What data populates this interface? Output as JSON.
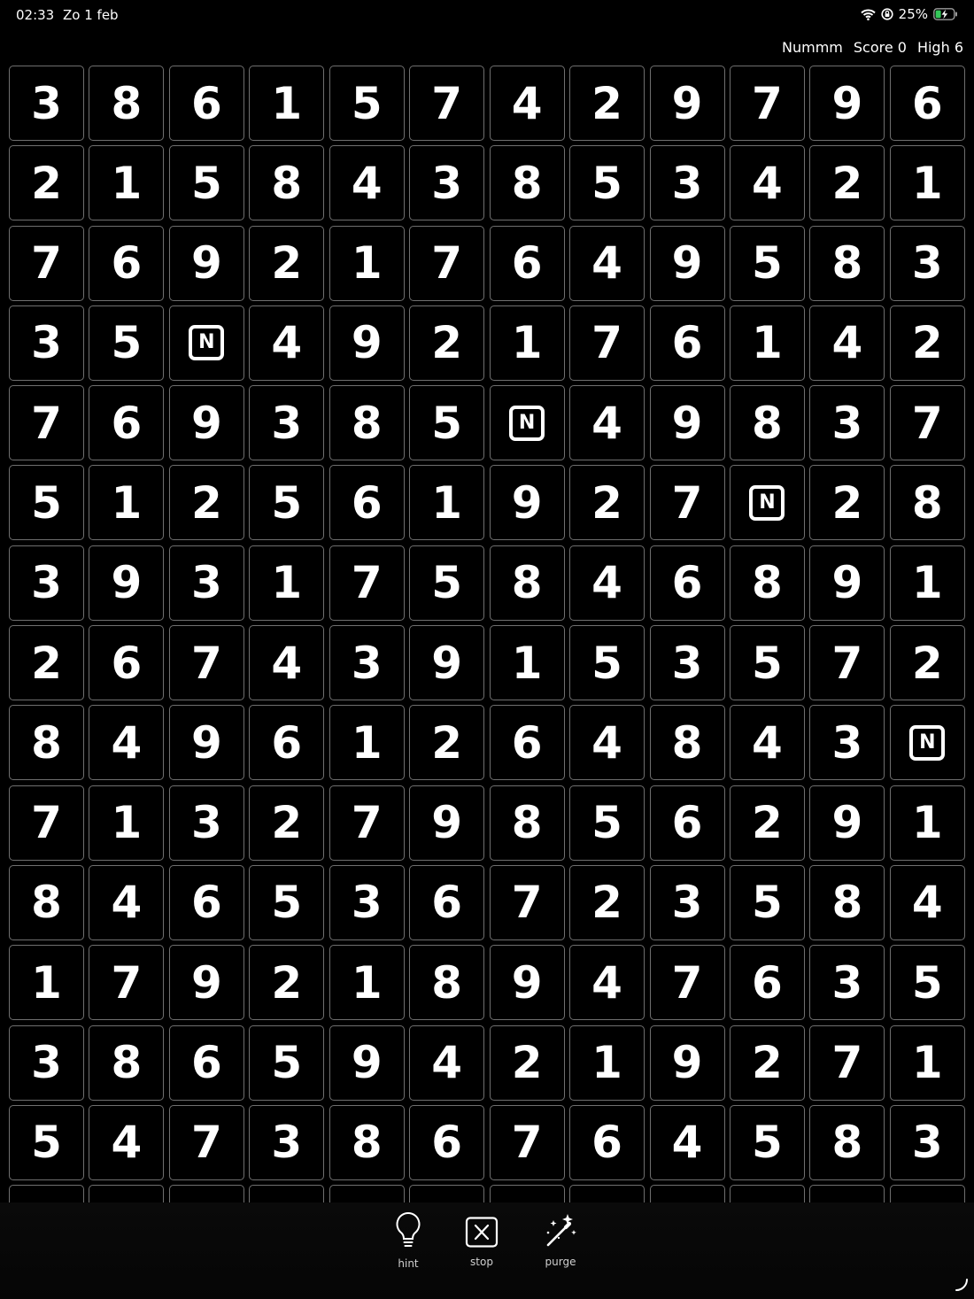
{
  "status_bar": {
    "time": "02:33",
    "date": "Zo 1 feb",
    "battery": "25%",
    "icons": [
      "wifi-icon",
      "orientation-lock-icon",
      "battery-charging-icon"
    ]
  },
  "header": {
    "app_name": "Nummm",
    "score": "Score 0",
    "high": "High 6"
  },
  "board": {
    "columns": 12,
    "special_tile_letter": "N",
    "rows": [
      [
        "3",
        "8",
        "6",
        "1",
        "5",
        "7",
        "4",
        "2",
        "9",
        "7",
        "9",
        "6"
      ],
      [
        "2",
        "1",
        "5",
        "8",
        "4",
        "3",
        "8",
        "5",
        "3",
        "4",
        "2",
        "1"
      ],
      [
        "7",
        "6",
        "9",
        "2",
        "1",
        "7",
        "6",
        "4",
        "9",
        "5",
        "8",
        "3"
      ],
      [
        "3",
        "5",
        "N",
        "4",
        "9",
        "2",
        "1",
        "7",
        "6",
        "1",
        "4",
        "2"
      ],
      [
        "7",
        "6",
        "9",
        "3",
        "8",
        "5",
        "N",
        "4",
        "9",
        "8",
        "3",
        "7"
      ],
      [
        "5",
        "1",
        "2",
        "5",
        "6",
        "1",
        "9",
        "2",
        "7",
        "N",
        "2",
        "8"
      ],
      [
        "3",
        "9",
        "3",
        "1",
        "7",
        "5",
        "8",
        "4",
        "6",
        "8",
        "9",
        "1"
      ],
      [
        "2",
        "6",
        "7",
        "4",
        "3",
        "9",
        "1",
        "5",
        "3",
        "5",
        "7",
        "2"
      ],
      [
        "8",
        "4",
        "9",
        "6",
        "1",
        "2",
        "6",
        "4",
        "8",
        "4",
        "3",
        "N"
      ],
      [
        "7",
        "1",
        "3",
        "2",
        "7",
        "9",
        "8",
        "5",
        "6",
        "2",
        "9",
        "1"
      ],
      [
        "8",
        "4",
        "6",
        "5",
        "3",
        "6",
        "7",
        "2",
        "3",
        "5",
        "8",
        "4"
      ],
      [
        "1",
        "7",
        "9",
        "2",
        "1",
        "8",
        "9",
        "4",
        "7",
        "6",
        "3",
        "5"
      ],
      [
        "3",
        "8",
        "6",
        "5",
        "9",
        "4",
        "2",
        "1",
        "9",
        "2",
        "7",
        "1"
      ],
      [
        "5",
        "4",
        "7",
        "3",
        "8",
        "6",
        "7",
        "6",
        "4",
        "5",
        "8",
        "3"
      ],
      [
        "",
        "",
        "",
        "",
        "",
        "",
        "",
        "",
        "",
        "",
        "",
        ""
      ]
    ]
  },
  "toolbar": {
    "hint_label": "hint",
    "stop_label": "stop",
    "purge_label": "purge"
  },
  "colors": {
    "background": "#000000",
    "tile_border": "#6f6f6f",
    "text": "#ffffff",
    "battery_charge": "#34c759"
  }
}
